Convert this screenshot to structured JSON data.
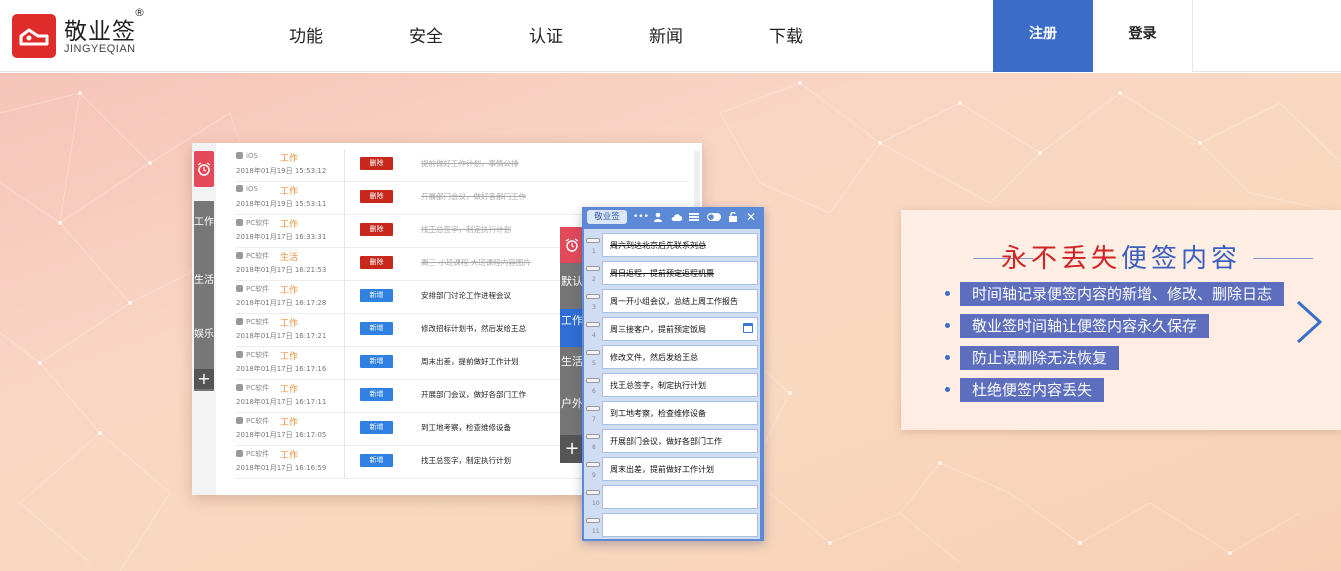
{
  "brand": {
    "name": "敬业签",
    "registered": "®",
    "pinyin": "JINGYEQIAN"
  },
  "nav": {
    "items": [
      "功能",
      "安全",
      "认证",
      "新闻",
      "下载"
    ]
  },
  "auth": {
    "register": "注册",
    "login": "登录"
  },
  "history_window": {
    "side_tabs": [
      "工作",
      "生活",
      "娱乐"
    ],
    "add": "+",
    "rows": [
      {
        "platform": "iOS",
        "category": "工作",
        "datetime": "2018年01月19日 15:53:12",
        "action": "删除",
        "text": "提前做好工作计划，事情公排",
        "done": true
      },
      {
        "platform": "iOS",
        "category": "工作",
        "datetime": "2018年01月19日 15:53:11",
        "action": "删除",
        "text": "开展部门会议，做好各部门工作",
        "done": true
      },
      {
        "platform": "PC软件",
        "category": "工作",
        "datetime": "2018年01月17日 16:33:31",
        "action": "删除",
        "text": "找王总签字，制定执行计划",
        "done": true
      },
      {
        "platform": "PC软件",
        "category": "生活",
        "datetime": "2018年01月17日 16:21:53",
        "action": "删除",
        "text": "周三 小班课程 大班课程内容图片",
        "done": true
      },
      {
        "platform": "PC软件",
        "category": "工作",
        "datetime": "2018年01月17日 16:17:28",
        "action": "新增",
        "text": "安排部门讨论工作进程会议",
        "done": false
      },
      {
        "platform": "PC软件",
        "category": "工作",
        "datetime": "2018年01月17日 16:17:21",
        "action": "新增",
        "text": "修改招标计划书，然后发给王总",
        "done": false
      },
      {
        "platform": "PC软件",
        "category": "工作",
        "datetime": "2018年01月17日 16:17:16",
        "action": "新增",
        "text": "周末出差，提前做好工作计划",
        "done": false
      },
      {
        "platform": "PC软件",
        "category": "工作",
        "datetime": "2018年01月17日 16:17:11",
        "action": "新增",
        "text": "开展部门会议，做好各部门工作",
        "done": false
      },
      {
        "platform": "PC软件",
        "category": "工作",
        "datetime": "2018年01月17日 16:17:05",
        "action": "新增",
        "text": "到工地考察，检查维修设备",
        "done": false
      },
      {
        "platform": "PC软件",
        "category": "工作",
        "datetime": "2018年01月17日 16:16:59",
        "action": "新增",
        "text": "找王总签字，制定执行计划",
        "done": false
      }
    ]
  },
  "note_window": {
    "name": "敬业签",
    "side_tabs": [
      "默认",
      "工作",
      "生活",
      "户外"
    ],
    "active_tab": "工作",
    "add": "+",
    "lines": [
      {
        "n": "1",
        "text": "周六到达北京后先联系刘总",
        "done": true
      },
      {
        "n": "2",
        "text": "周日返程，提前预定返程机票",
        "done": true
      },
      {
        "n": "3",
        "text": "周一开小组会议，总结上周工作报告",
        "done": false
      },
      {
        "n": "4",
        "text": "周三接客户，提前预定饭局",
        "done": false
      },
      {
        "n": "5",
        "text": "修改文件，然后发给王总",
        "done": false
      },
      {
        "n": "6",
        "text": "找王总签字，制定执行计划",
        "done": false
      },
      {
        "n": "7",
        "text": "到工地考察，检查维修设备",
        "done": false
      },
      {
        "n": "8",
        "text": "开展部门会议，做好各部门工作",
        "done": false
      },
      {
        "n": "9",
        "text": "周末出差，提前做好工作计划",
        "done": false
      },
      {
        "n": "10",
        "text": "",
        "done": false
      },
      {
        "n": "11",
        "text": "",
        "done": false
      }
    ]
  },
  "features": {
    "title_red": "永不丢失",
    "title_blue": "便签内容",
    "items": [
      "时间轴记录便签内容的新增、修改、删除日志",
      "敬业签时间轴让便签内容永久保存",
      "防止误删除无法恢复",
      "杜绝便签内容丢失"
    ]
  },
  "colors": {
    "brand_red": "#e02b2b",
    "accent_blue": "#3b6cc8",
    "feature_bar": "#5d6ebf",
    "title_red": "#d32222"
  }
}
